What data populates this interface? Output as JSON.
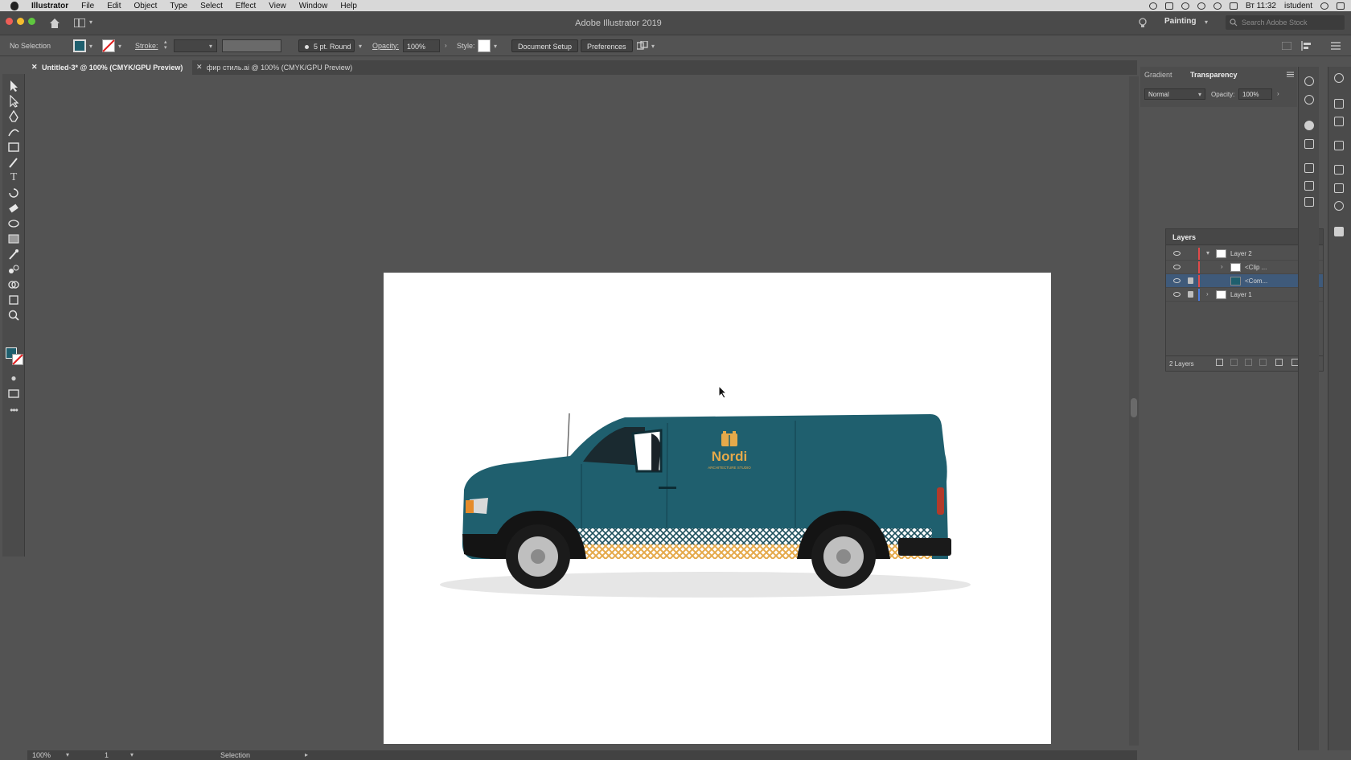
{
  "menubar": {
    "app_name": "Illustrator",
    "items": [
      "File",
      "Edit",
      "Object",
      "Type",
      "Select",
      "Effect",
      "View",
      "Window",
      "Help"
    ],
    "clock": "Вт 11:32",
    "user": "istudent"
  },
  "titlebar": {
    "title": "Adobe Illustrator 2019",
    "workspace": "Painting",
    "search_placeholder": "Search Adobe Stock"
  },
  "controlbar": {
    "selection": "No Selection",
    "stroke_label": "Stroke:",
    "brush": "5 pt. Round",
    "opacity_label": "Opacity:",
    "opacity_value": "100%",
    "style_label": "Style:",
    "document_setup": "Document Setup",
    "preferences": "Preferences",
    "fill_color": "#1f5f6e"
  },
  "tabs": [
    {
      "label": "Untitled-3* @ 100% (CMYK/GPU Preview)",
      "active": true
    },
    {
      "label": "фир стиль.ai @ 100% (CMYK/GPU Preview)",
      "active": false
    }
  ],
  "transparency": {
    "tabs": [
      "Gradient",
      "Transparency"
    ],
    "blend_mode": "Normal",
    "opacity_label": "Opacity:",
    "opacity_value": "100%"
  },
  "layers": {
    "title": "Layers",
    "rows": [
      {
        "name": "Layer 2",
        "color": "#e04b4b",
        "locked": false,
        "selected": false
      },
      {
        "name": "<Clip ...",
        "color": "#e04b4b",
        "locked": false,
        "selected": false
      },
      {
        "name": "<Com...",
        "color": "#e04b4b",
        "locked": true,
        "selected": true
      },
      {
        "name": "Layer 1",
        "color": "#4a7be0",
        "locked": true,
        "selected": false
      }
    ],
    "count": "2 Layers"
  },
  "artwork": {
    "brand": "Nordi",
    "tagline": "ARCHITECTURE STUDIO",
    "van_color": "#1f5f6e",
    "accent_color": "#e5a94a"
  },
  "statusbar": {
    "zoom": "100%",
    "artboard": "1",
    "tool": "Selection"
  }
}
